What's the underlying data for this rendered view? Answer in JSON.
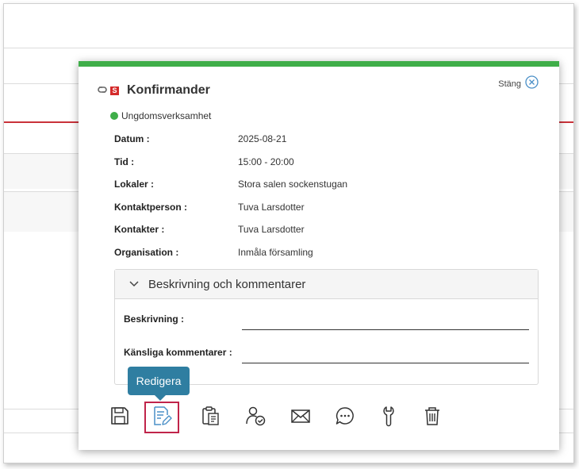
{
  "dialog": {
    "title": "Konfirmander",
    "close_label": "Stäng",
    "category": "Ungdomsverksamhet",
    "badge_letter": "S"
  },
  "fields": [
    {
      "label": "Datum :",
      "value": "2025-08-21"
    },
    {
      "label": "Tid :",
      "value": "15:00 - 20:00"
    },
    {
      "label": "Lokaler :",
      "value": "Stora salen sockenstugan"
    },
    {
      "label": "Kontaktperson :",
      "value": "Tuva Larsdotter"
    },
    {
      "label": "Kontakter :",
      "value": "Tuva Larsdotter"
    },
    {
      "label": "Organisation :",
      "value": "Inmåla församling"
    }
  ],
  "panel": {
    "title": "Beskrivning och kommentarer",
    "description_label": "Beskrivning :",
    "sensitive_label": "Känsliga kommentarer :"
  },
  "tooltip": "Redigera",
  "toolbar": [
    {
      "name": "save-icon"
    },
    {
      "name": "edit-icon"
    },
    {
      "name": "clipboard-icon"
    },
    {
      "name": "person-check-icon"
    },
    {
      "name": "mail-icon"
    },
    {
      "name": "chat-icon"
    },
    {
      "name": "wrench-icon"
    },
    {
      "name": "trash-icon"
    }
  ],
  "colors": {
    "accent_green": "#3fae49",
    "tooltip_blue": "#2f7ea1",
    "active_border": "#c0244a",
    "badge_red": "#d42a2a",
    "icon_blue": "#4a8fc7"
  }
}
